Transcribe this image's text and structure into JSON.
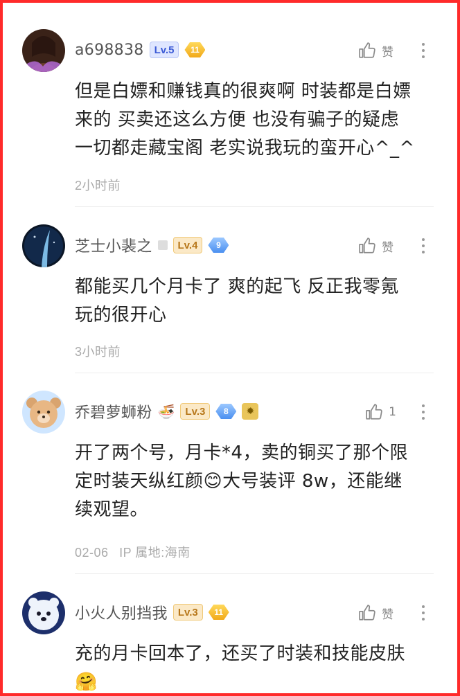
{
  "comments": [
    {
      "username": "a698838",
      "level": "Lv.5",
      "medal": "11",
      "like_label": "赞",
      "lines": [
        "但是白嫖和赚钱真的很爽啊 时装都是白嫖",
        "来的 买卖还这么方便 也没有骗子的疑虑",
        "一切都走藏宝阁 老实说我玩的蛮开心^_^"
      ],
      "time": "2小时前"
    },
    {
      "username": "芝士小裴之",
      "level": "Lv.4",
      "medal": "9",
      "like_label": "赞",
      "lines": [
        "都能买几个月卡了 爽的起飞 反正我零氪",
        "玩的很开心"
      ],
      "time": "3小时前"
    },
    {
      "username": "乔碧萝蛳粉",
      "username_emoji": "🍜",
      "level": "Lv.3",
      "medal": "8",
      "like_count": "1",
      "lines": [
        "开了两个号，月卡*4，卖的铜买了那个限",
        "定时装天纵红颜",
        "大号装评 8w，还能继",
        "续观望。"
      ],
      "line2_emoji": "😊",
      "time": "02-06",
      "location": "IP 属地:海南"
    },
    {
      "username": "小火人别挡我",
      "level": "Lv.3",
      "medal": "11",
      "like_label": "赞",
      "lines": [
        "充的月卡回本了，还买了时装和技能皮肤"
      ],
      "trailing_emoji": "🤗"
    }
  ],
  "icons": {
    "like": "thumbs-up-icon",
    "more": "more-vertical-icon"
  },
  "colors": {
    "border": "#ff2a2a",
    "level_blue": "#3c5bd6",
    "level_gold": "#b7771a",
    "meta_gray": "#aaaaaa"
  }
}
